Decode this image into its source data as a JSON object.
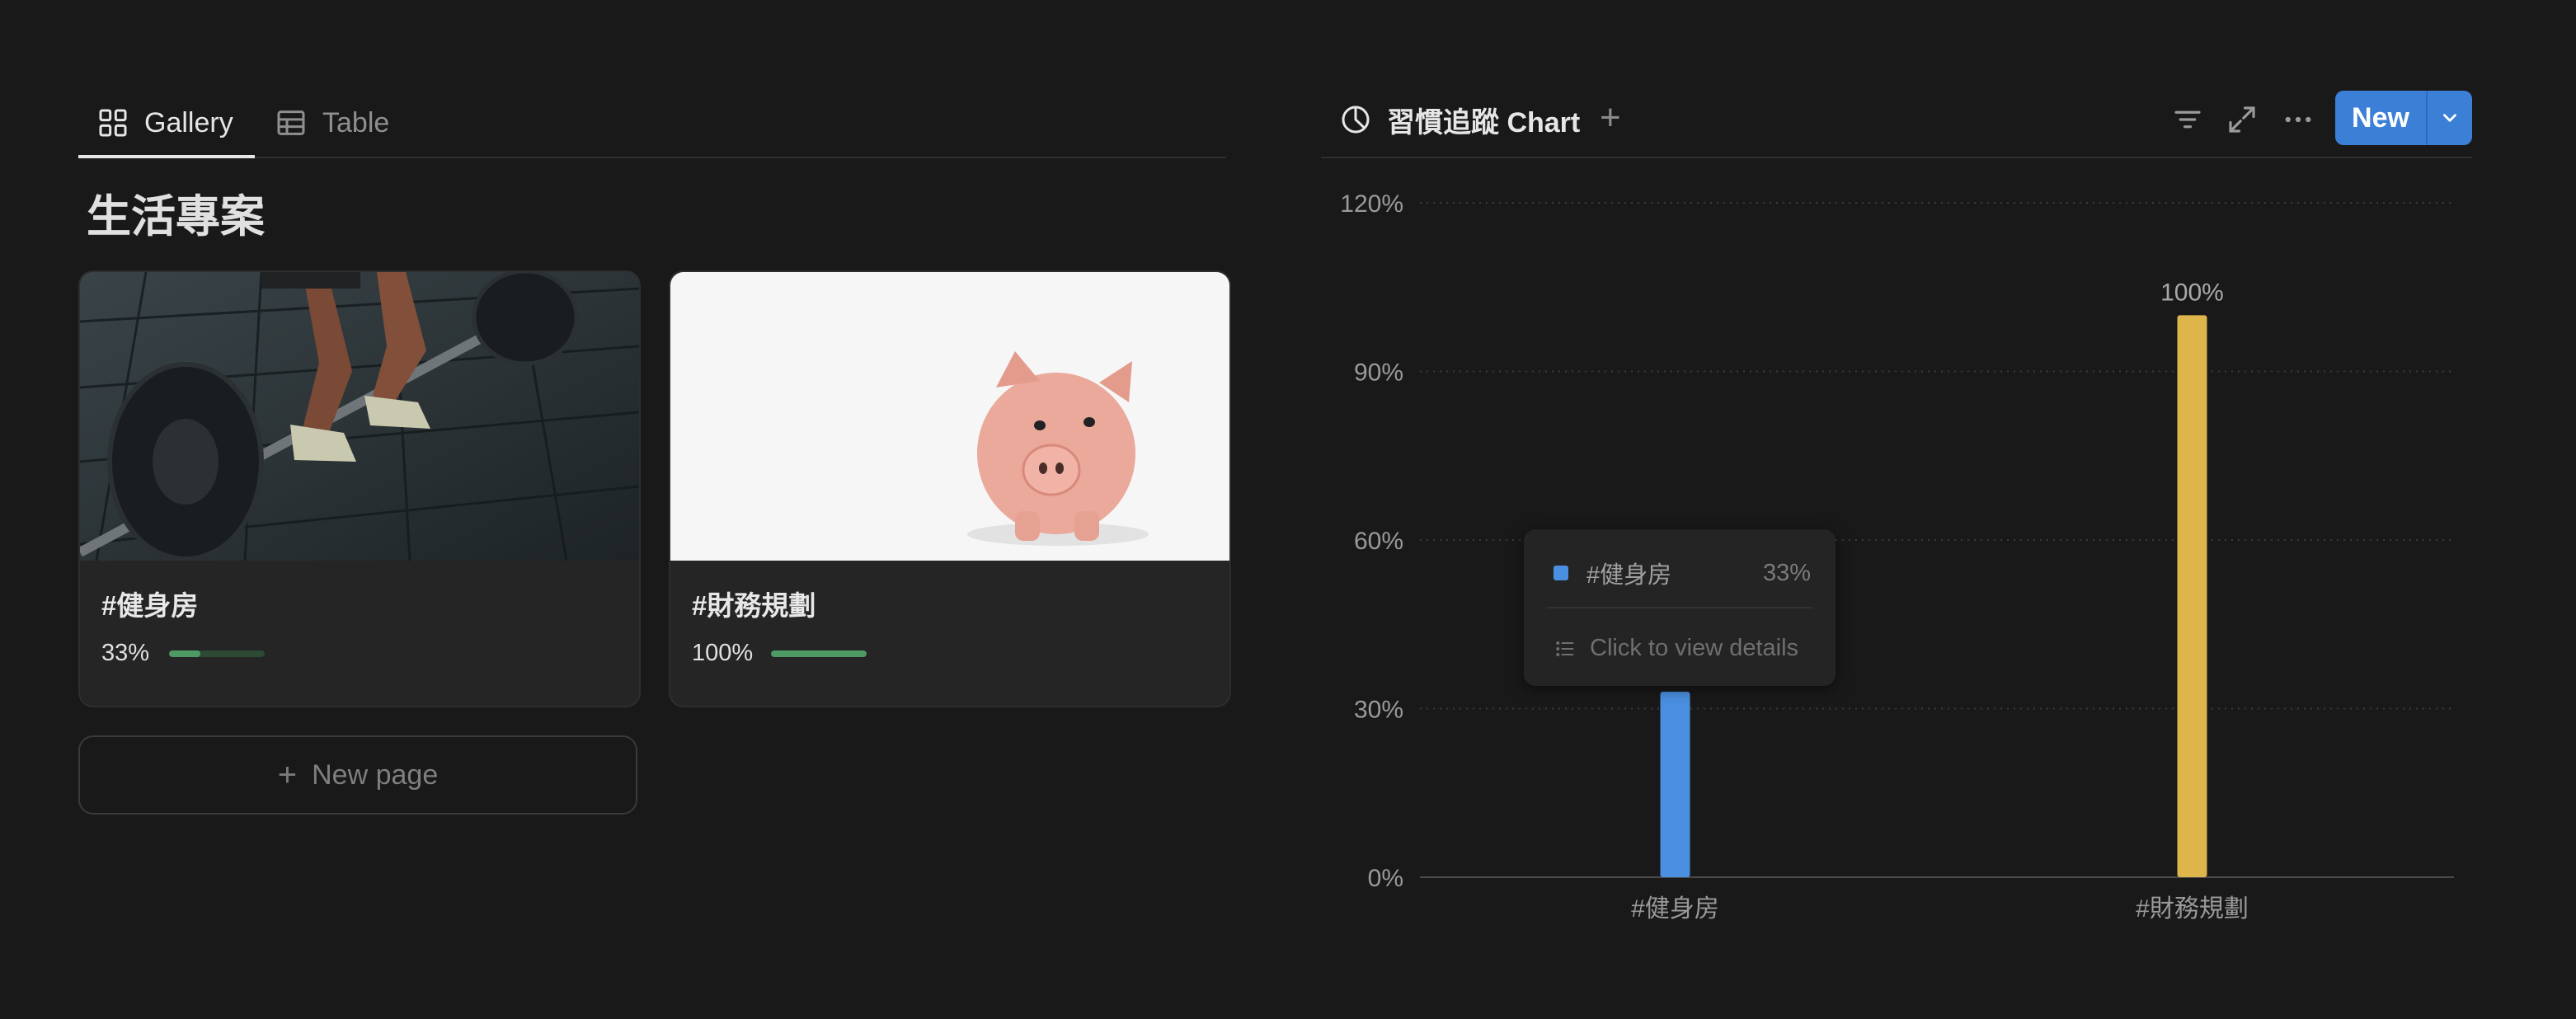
{
  "gallery": {
    "tabs": [
      {
        "label": "Gallery",
        "icon": "gallery-grid-icon",
        "active": true
      },
      {
        "label": "Table",
        "icon": "table-icon",
        "active": false
      }
    ],
    "title": "生活專案",
    "cards": [
      {
        "title": "#健身房",
        "progress_label": "33%",
        "progress": 0.33,
        "cover": "barbell-photo"
      },
      {
        "title": "#財務規劃",
        "progress_label": "100%",
        "progress": 1.0,
        "cover": "piggy-bank-photo"
      }
    ],
    "new_page_label": "New page"
  },
  "chart_view": {
    "view_name": "習慣追蹤 Chart",
    "new_button_label": "New",
    "icons": [
      "chart-pie-icon",
      "plus-icon",
      "filter-icon",
      "expand-icon",
      "more-icon",
      "chevron-down-icon"
    ],
    "accent_color": "#3b7fd6"
  },
  "chart_data": {
    "type": "bar",
    "categories": [
      "#健身房",
      "#財務規劃"
    ],
    "values": [
      33,
      100
    ],
    "value_labels": [
      "33%",
      "100%"
    ],
    "colors": [
      "#4a8fe0",
      "#ddb54a"
    ],
    "y_ticks": [
      "0%",
      "30%",
      "60%",
      "90%",
      "120%"
    ],
    "ylim": [
      0,
      120
    ],
    "grid": true,
    "legend": "none"
  },
  "tooltip": {
    "name": "#健身房",
    "value": "33%",
    "link_label": "Click to view details"
  }
}
